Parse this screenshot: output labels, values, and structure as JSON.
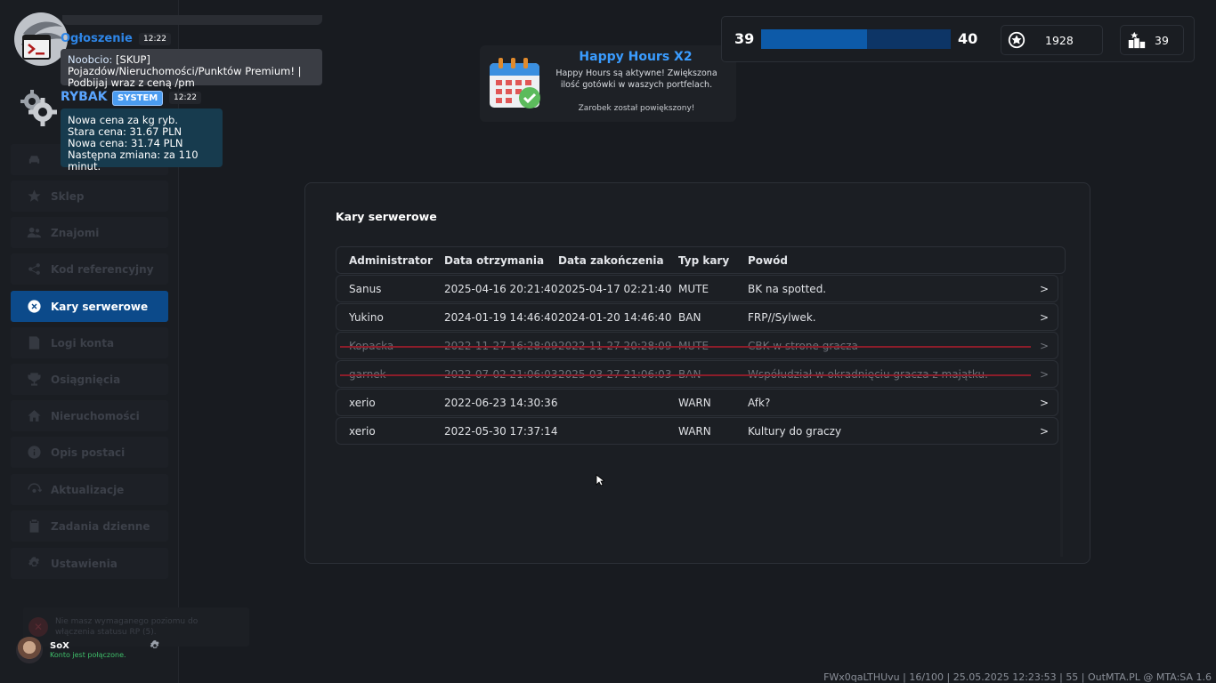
{
  "sidebar": {
    "items": [
      {
        "label": "Sklep",
        "icon": "star-icon"
      },
      {
        "label": "Znajomi",
        "icon": "users-icon"
      },
      {
        "label": "Kod referencyjny",
        "icon": "referral-icon"
      },
      {
        "label": "Kary serwerowe",
        "icon": "close-circle-icon"
      },
      {
        "label": "Logi konta",
        "icon": "logs-icon"
      },
      {
        "label": "Osiągnięcia",
        "icon": "trophy-icon"
      },
      {
        "label": "Nieruchomości",
        "icon": "house-icon"
      },
      {
        "label": "Opis postaci",
        "icon": "info-icon"
      },
      {
        "label": "Aktualizacje",
        "icon": "updates-icon"
      },
      {
        "label": "Zadania dzienne",
        "icon": "clipboard-icon"
      },
      {
        "label": "Ustawienia",
        "icon": "gear-icon"
      }
    ],
    "warning": "Nie masz wymaganego poziomu do włączenia statusu RP (5).",
    "user": {
      "name": "SoX",
      "status": "Konto jest połączone."
    }
  },
  "chat": {
    "announcement": {
      "title": "Ogłoszenie",
      "time": "12:22",
      "nick": "Noobcio:",
      "text": " [SKUP] Pojazdów/Nieruchomości/Punktów Premium! | Podbijaj wraz z ceną /pm"
    },
    "rybak": {
      "name": "RYBAK",
      "badge": "SYSTEM",
      "time": "12:22",
      "line1": "Nowa cena za kg ryb.",
      "line2": "Stara cena: 31.67 PLN",
      "line3": "Nowa cena: 31.74 PLN",
      "line4": "Następna zmiana: za 110 minut."
    }
  },
  "happy_hours": {
    "title": "Happy Hours X2",
    "text": "Happy Hours są aktywne! Zwiększona ilość gotówki w waszych portfelach.",
    "sub": "Zarobek został powiększony!"
  },
  "stats": {
    "level_current": "39",
    "level_next": "40",
    "xp_progress": 0.56,
    "coins": "1928",
    "rank": "39"
  },
  "panel": {
    "title": "Kary serwerowe",
    "columns": [
      "Administrator",
      "Data otrzymania",
      "Data zakończenia",
      "Typ kary",
      "Powód"
    ],
    "rows": [
      {
        "admin": "Sanus",
        "received": "2025-04-16 20:21:40",
        "ends": "2025-04-17 02:21:40",
        "type": "MUTE",
        "reason": "BK na spotted.",
        "expired": false
      },
      {
        "admin": "Yukino",
        "received": "2024-01-19 14:46:40",
        "ends": "2024-01-20 14:46:40",
        "type": "BAN",
        "reason": "FRP//Sylwek.",
        "expired": false
      },
      {
        "admin": "Kopacka",
        "received": "2022-11-27 16:28:09",
        "ends": "2022-11-27 20:28:09",
        "type": "MUTE",
        "reason": "CBK w strone gracza",
        "expired": true
      },
      {
        "admin": "garnek",
        "received": "2022-07-02 21:06:03",
        "ends": "2025-03-27 21:06:03",
        "type": "BAN",
        "reason": "Współudział w okradnięciu gracza z majątku.",
        "expired": true
      },
      {
        "admin": "xerio",
        "received": "2022-06-23 14:30:36",
        "ends": "",
        "type": "WARN",
        "reason": "Afk?",
        "expired": false
      },
      {
        "admin": "xerio",
        "received": "2022-05-30 17:37:14",
        "ends": "",
        "type": "WARN",
        "reason": "Kultury do graczy",
        "expired": false
      }
    ],
    "arrow": ">"
  },
  "footer": "FWx0qaLTHUvu | 16/100 | 25.05.2025 12:23:53 | 55 | OutMTA.PL @ MTA:SA 1.6"
}
